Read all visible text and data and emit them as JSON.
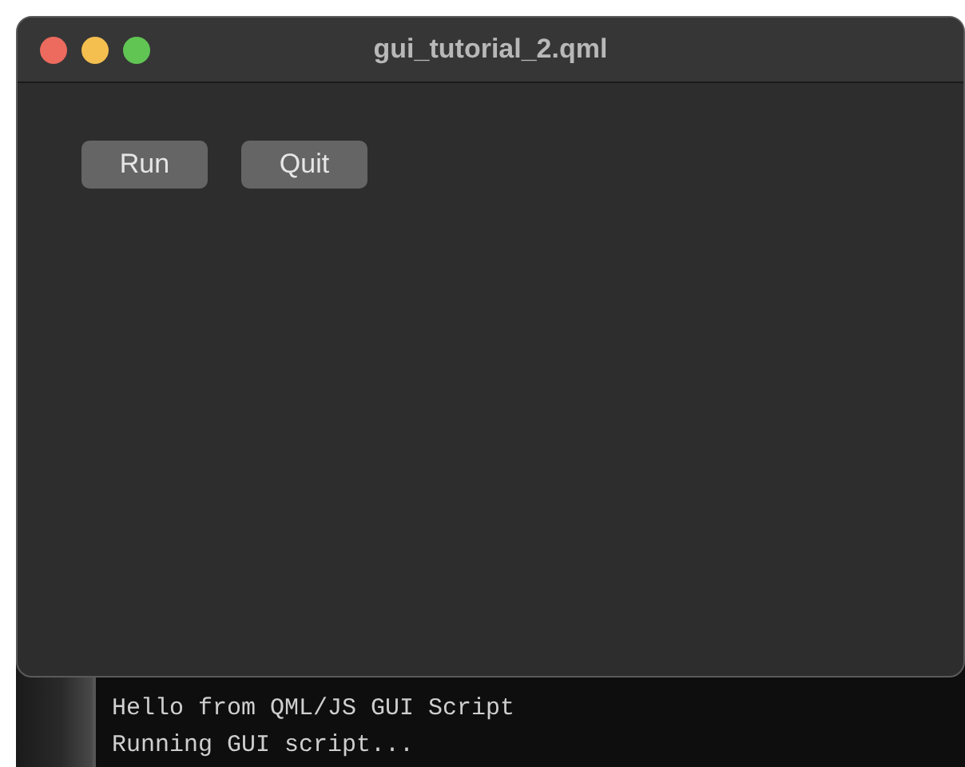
{
  "window": {
    "title": "gui_tutorial_2.qml"
  },
  "buttons": [
    {
      "label": "Run"
    },
    {
      "label": "Quit"
    }
  ],
  "terminal": {
    "lines": [
      "Hello from QML/JS GUI Script",
      "Running GUI script..."
    ]
  }
}
